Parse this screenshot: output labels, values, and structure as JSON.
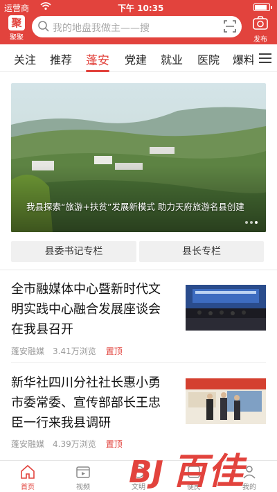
{
  "status": {
    "carrier": "运营商",
    "time": "下午 10:35",
    "battery_level": 0.85
  },
  "header": {
    "logo_label": "聚聚",
    "logo_mark": "聚",
    "search_placeholder": "我的地盘我做主——搜",
    "publish_label": "发布"
  },
  "tabs": [
    "关注",
    "推荐",
    "蓬安",
    "党建",
    "就业",
    "医院",
    "爆料"
  ],
  "active_tab": "蓬安",
  "hero": {
    "caption": "我县探索“旅游+扶贫”发展新模式 助力天府旅游名县创建",
    "slide_count": 3,
    "active_slide": 3
  },
  "columns": [
    "县委书记专栏",
    "县长专栏"
  ],
  "news": [
    {
      "title": "全市融媒体中心暨新时代文明实践中心融合发展座谈会在我县召开",
      "source": "蓬安融媒",
      "views": "3.41万浏览",
      "tag": "置顶"
    },
    {
      "title": "新华社四川分社社长惠小勇市委常委、宣传部部长王忠臣一行来我县调研",
      "source": "蓬安融媒",
      "views": "4.39万浏览",
      "tag": "置顶"
    }
  ],
  "bottom_nav": [
    {
      "label": "首页",
      "icon": "home-icon",
      "active": true
    },
    {
      "label": "视频",
      "icon": "video-icon",
      "active": false
    },
    {
      "label": "文明",
      "icon": "civility-icon",
      "active": false
    },
    {
      "label": "便民",
      "icon": "service-icon",
      "active": false
    },
    {
      "label": "我的",
      "icon": "user-icon",
      "active": false
    }
  ],
  "watermark": {
    "text": "百佳",
    "mark": "BJ"
  },
  "colors": {
    "accent": "#e2433d",
    "muted": "#999999"
  }
}
